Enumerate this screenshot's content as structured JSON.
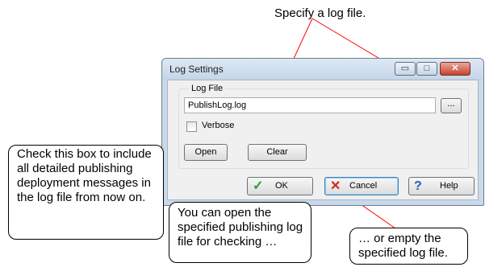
{
  "annotations": {
    "specify_log_file": "Specify a log file.",
    "verbose_note": "Check this box to include all detailed publishing deployment messages in the log file from now on.",
    "open_note": "You can open the specified publishing log file for checking …",
    "clear_note": "… or empty the specified log file."
  },
  "dialog": {
    "title": "Log Settings",
    "group_label": "Log File",
    "log_file_value": "PublishLog.log",
    "browse_label": "...",
    "verbose_label": "Verbose",
    "verbose_checked": false,
    "open_label": "Open",
    "clear_label": "Clear",
    "ok_label": "OK",
    "cancel_label": "Cancel",
    "help_label": "Help",
    "window_buttons": {
      "minimize": "▭",
      "maximize": "□",
      "close": "✕"
    },
    "icons": {
      "ok": "check-icon",
      "cancel": "x-icon",
      "help": "question-icon"
    }
  }
}
